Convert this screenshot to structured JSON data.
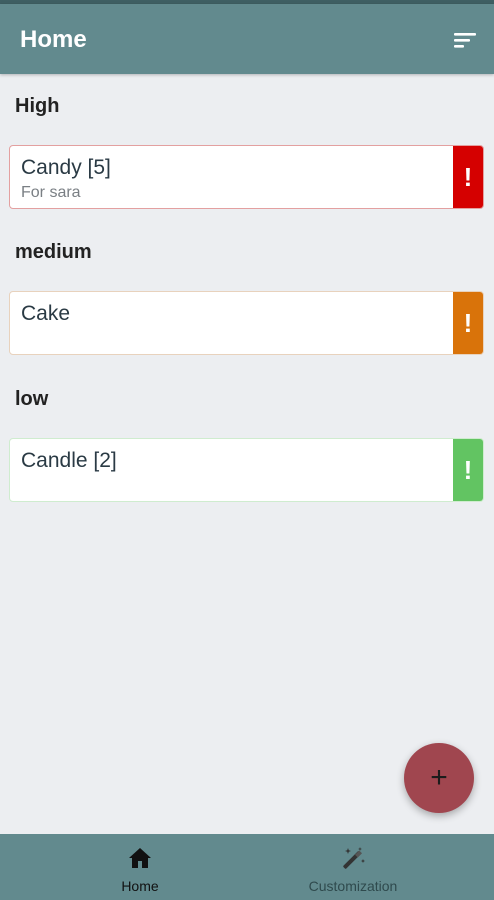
{
  "app_bar": {
    "title": "Home",
    "sort_icon": "sort-icon"
  },
  "sections": [
    {
      "title": "High",
      "color": "#d50000",
      "items": [
        {
          "title": "Candy [5]",
          "subtitle": "For sara",
          "flag_icon": "!"
        }
      ]
    },
    {
      "title": "medium",
      "color": "#d9730a",
      "items": [
        {
          "title": "Cake",
          "subtitle": "",
          "flag_icon": "!"
        }
      ]
    },
    {
      "title": "low",
      "color": "#62c462",
      "items": [
        {
          "title": "Candle [2]",
          "subtitle": "",
          "flag_icon": "!"
        }
      ]
    }
  ],
  "fab": {
    "label": "+",
    "icon": "add-icon",
    "color": "#a0464f"
  },
  "bottom_nav": {
    "items": [
      {
        "label": "Home",
        "icon": "home-icon",
        "active": true
      },
      {
        "label": "Customization",
        "icon": "magic-wand-icon",
        "active": false
      }
    ]
  },
  "colors": {
    "app_bar": "#628a8e",
    "background": "#eceef1"
  }
}
